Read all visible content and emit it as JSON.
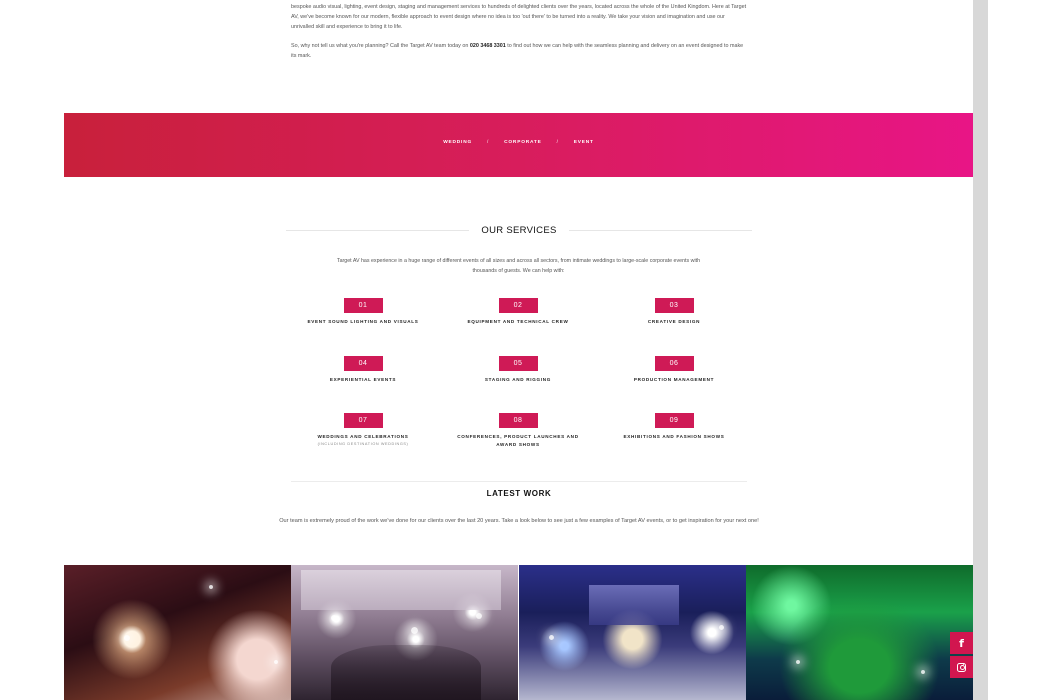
{
  "intro": {
    "paragraph1": "our clients, where every detail is just as you imagined it.Our approachable and dependable technicals and production managers have more than 20 years' experience in the industry, providing bespoke audio visual, lighting, event design, staging and management services to hundreds of delighted clients over the years, located across the whole of the United Kingdom. Here at Target AV, we've become known for our modern, flexible approach to event design where no idea is too 'out there' to be turned into a reality. We take your vision and imagination and use our unrivalled skill and experience to bring it to life.",
    "paragraph2_before": "So, why not tell us what you're planning? Call the Target AV team today on ",
    "phone": "020 3468 3301",
    "paragraph2_after": " to find out how we can help with the seamless planning and delivery on an event designed to make its mark."
  },
  "banner": {
    "links": [
      "WEDDING",
      "CORPORATE",
      "EVENT"
    ],
    "separator": "/",
    "gradient_start": "#c8203b",
    "gradient_end": "#e81586"
  },
  "services": {
    "title": "OUR SERVICES",
    "intro": "Target AV has experience in a huge range of different events of all sizes and across all sectors, from intimate weddings to large-scale corporate events with thousands of guests. We can help with:",
    "items": [
      {
        "num": "01",
        "label": "EVENT SOUND LIGHTING AND VISUALS",
        "sub": ""
      },
      {
        "num": "02",
        "label": "EQUIPMENT AND TECHNICAL CREW",
        "sub": ""
      },
      {
        "num": "03",
        "label": "CREATIVE DESIGN",
        "sub": ""
      },
      {
        "num": "04",
        "label": "EXPERIENTIAL EVENTS",
        "sub": ""
      },
      {
        "num": "05",
        "label": "STAGING AND RIGGING",
        "sub": ""
      },
      {
        "num": "06",
        "label": "PRODUCTION MANAGEMENT",
        "sub": ""
      },
      {
        "num": "07",
        "label": "WEDDINGS AND CELEBRATIONS",
        "sub": "(INCLUDING DESTINATION WEDDINGS)"
      },
      {
        "num": "08",
        "label": "CONFERENCES, PRODUCT LAUNCHES AND AWARD SHOWS",
        "sub": ""
      },
      {
        "num": "09",
        "label": "EXHIBITIONS AND FASHION SHOWS",
        "sub": ""
      }
    ],
    "accent": "#cf1a56"
  },
  "latest": {
    "title": "LATEST WORK",
    "intro": "Our team is extremely proud of the work we've done for our clients over the last 20 years. Take a look below to see just a few examples of Target AV events, or to get inspiration for your next one!"
  },
  "gallery": {
    "tiles": [
      "event-photo-wedding-cake",
      "event-photo-stage-lights",
      "event-photo-banquet-stage",
      "event-photo-green-stage"
    ]
  },
  "social": {
    "facebook_glyph": "f",
    "icons": [
      "facebook-icon",
      "instagram-icon"
    ],
    "color": "#d1164f"
  }
}
